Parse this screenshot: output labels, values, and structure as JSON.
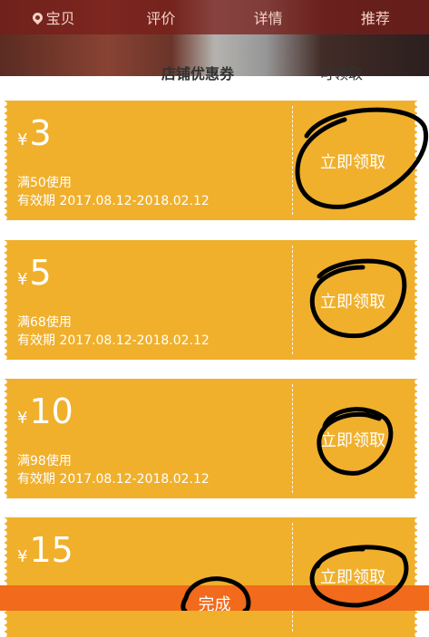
{
  "tabs": [
    {
      "label": "宝贝",
      "icon": "location-pin-icon"
    },
    {
      "label": "评价"
    },
    {
      "label": "详情"
    },
    {
      "label": "推荐"
    }
  ],
  "sheet": {
    "title_partial": "店铺优惠券",
    "right_partial": "可领取"
  },
  "coupons": [
    {
      "currency": "¥",
      "amount": "3",
      "condition": "满50使用",
      "validity": "有效期 2017.08.12-2018.02.12",
      "claim_label": "立即领取"
    },
    {
      "currency": "¥",
      "amount": "5",
      "condition": "满68使用",
      "validity": "有效期 2017.08.12-2018.02.12",
      "claim_label": "立即领取"
    },
    {
      "currency": "¥",
      "amount": "10",
      "condition": "满98使用",
      "validity": "有效期 2017.08.12-2018.02.12",
      "claim_label": "立即领取"
    },
    {
      "currency": "¥",
      "amount": "15",
      "condition": "",
      "validity": "",
      "claim_label": "立即领取"
    }
  ],
  "footer": {
    "done_label": "完成"
  },
  "colors": {
    "coupon": "#f0b02c",
    "done_bar": "#f26a1b",
    "tabbar": "#7a1e19"
  }
}
